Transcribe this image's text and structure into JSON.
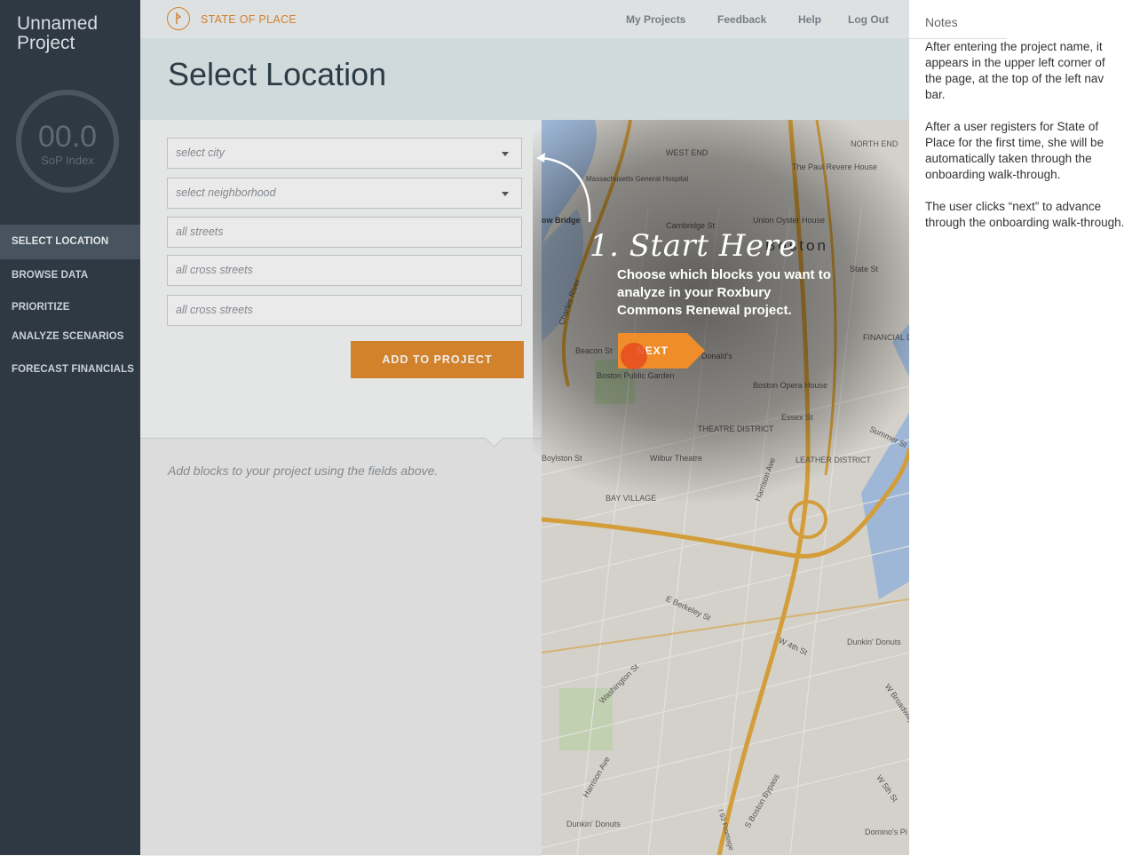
{
  "sidebar": {
    "project_name": "Unnamed Project",
    "score": {
      "value": "00.0",
      "label": "SoP Index"
    },
    "items": [
      {
        "label": "SELECT LOCATION",
        "active": true
      },
      {
        "label": "BROWSE DATA"
      },
      {
        "label": "PRIORITIZE"
      },
      {
        "label": "ANALYZE SCENARIOS"
      },
      {
        "label": "FORECAST FINANCIALS"
      }
    ]
  },
  "header": {
    "brand": "STATE OF PLACE",
    "nav": [
      "My Projects",
      "Feedback",
      "Help",
      "Log Out"
    ]
  },
  "page": {
    "title": "Select Location"
  },
  "form": {
    "city_placeholder": "select city",
    "neighborhood_placeholder": "select neighborhood",
    "streets_placeholder": "all streets",
    "cross_streets_placeholder": "all cross streets",
    "cross_streets2_placeholder": "all cross streets",
    "add_button": "ADD TO PROJECT",
    "hint": "Add blocks to your project using the fields above."
  },
  "coach": {
    "title": "1. Start Here",
    "text": "Choose which blocks you want to analyze in your Roxbury Commons Renewal project.",
    "next": "NEXT"
  },
  "map": {
    "labels": [
      "Massachusetts General Hospital",
      "WEST END",
      "NORTH END",
      "The Paul Revere House",
      "Cambridge St",
      "Union Oyster House",
      "Boston",
      "State St",
      "Charles River",
      "FINANCIAL DISTRICT",
      "Beacon St",
      "Boston Public Garden",
      "Boston Opera House",
      "THEATRE DISTRICT",
      "Essex St",
      "Boylston St",
      "Wilbur Theatre",
      "LEATHER DISTRICT",
      "Harrison Ave",
      "BAY VILLAGE",
      "E Berkeley St",
      "W 4th St",
      "Dunkin' Donuts",
      "Washington St",
      "Harrison Ave",
      "Dunkin' Donuts",
      "S Boston Bypass",
      "Domino's Pi",
      "Summer St",
      "W Broadway",
      "W 5th St",
      "Donald's",
      "ow Bridge",
      "I 93 Frontage"
    ]
  },
  "notes": {
    "title": "Notes",
    "paragraphs": [
      "After entering the project name, it appears in the upper left corner of the page, at the top of the left nav bar.",
      "After a user registers for State of Place for the first time, she will be automatically taken through the onboarding walk-through.",
      "The user clicks “next” to advance through the onboarding walk-through."
    ]
  }
}
